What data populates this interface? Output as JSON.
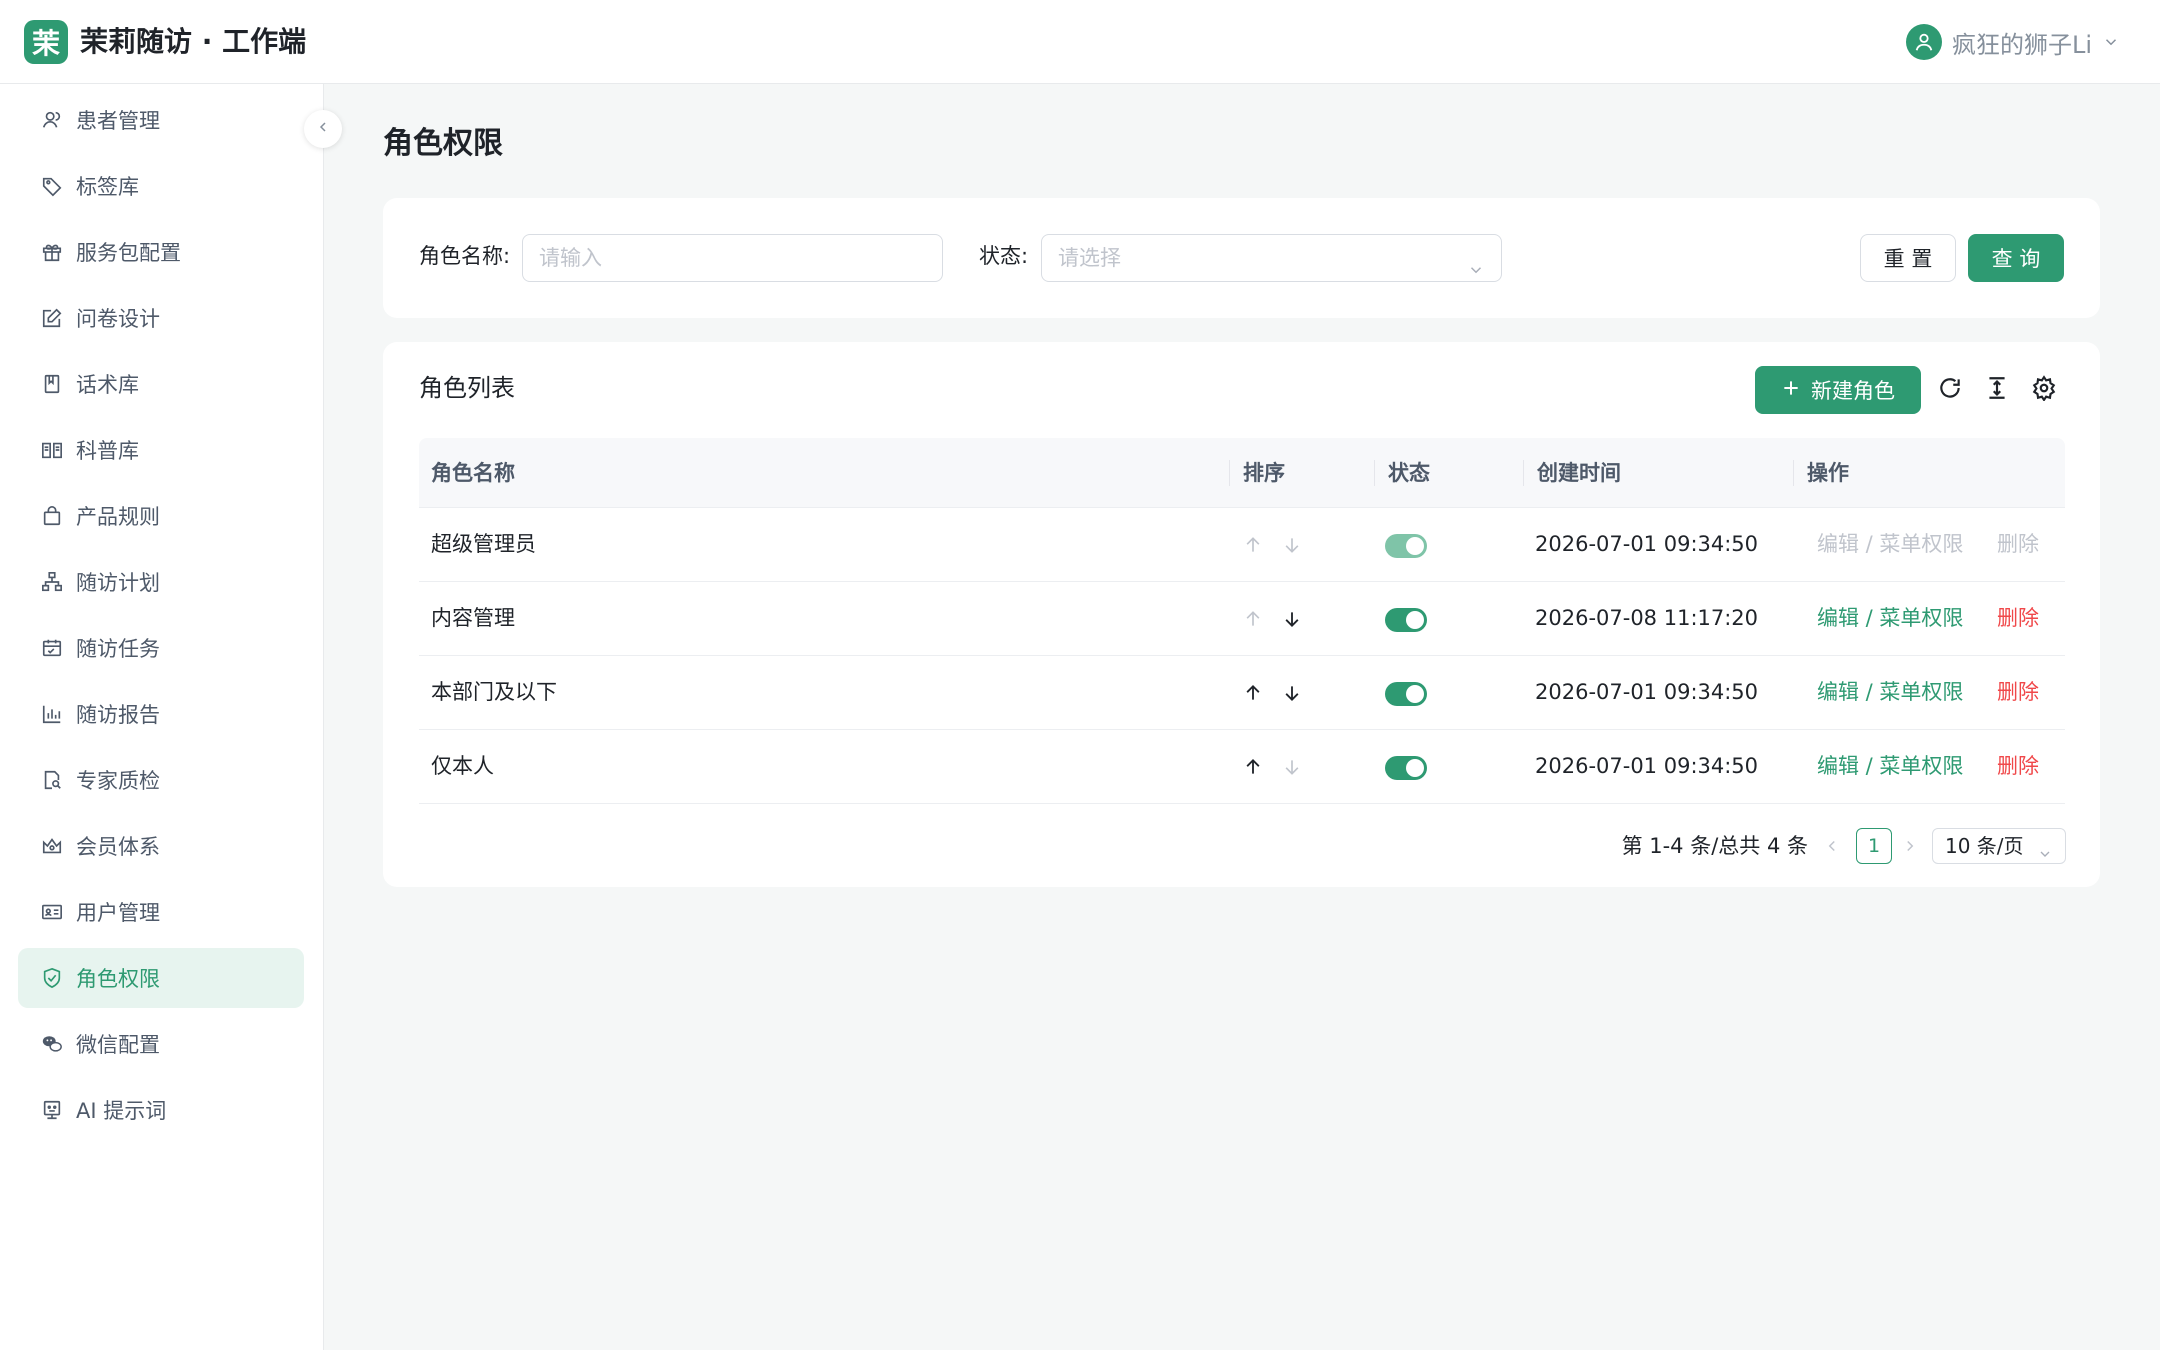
{
  "header": {
    "logo_char": "茉",
    "title": "茉莉随访 · 工作端",
    "user_name": "疯狂的狮子Li",
    "accent": "#2e9a72"
  },
  "sidebar": {
    "items": [
      {
        "label": "患者管理",
        "icon": "patients-icon"
      },
      {
        "label": "标签库",
        "icon": "tag-icon"
      },
      {
        "label": "服务包配置",
        "icon": "gift-icon"
      },
      {
        "label": "问卷设计",
        "icon": "edit-form-icon"
      },
      {
        "label": "话术库",
        "icon": "book-icon"
      },
      {
        "label": "科普库",
        "icon": "open-book-icon"
      },
      {
        "label": "产品规则",
        "icon": "bag-icon"
      },
      {
        "label": "随访计划",
        "icon": "org-chart-icon"
      },
      {
        "label": "随访任务",
        "icon": "calendar-check-icon"
      },
      {
        "label": "随访报告",
        "icon": "bar-chart-icon"
      },
      {
        "label": "专家质检",
        "icon": "doc-search-icon"
      },
      {
        "label": "会员体系",
        "icon": "crown-icon"
      },
      {
        "label": "用户管理",
        "icon": "id-card-icon"
      },
      {
        "label": "角色权限",
        "icon": "shield-icon",
        "active": true
      },
      {
        "label": "微信配置",
        "icon": "wechat-icon"
      },
      {
        "label": "AI 提示词",
        "icon": "robot-icon"
      }
    ]
  },
  "page": {
    "title": "角色权限"
  },
  "filter": {
    "role_name_label": "角色名称:",
    "role_name_placeholder": "请输入",
    "status_label": "状态:",
    "status_placeholder": "请选择",
    "reset_label": "重 置",
    "search_label": "查 询"
  },
  "list": {
    "title": "角色列表",
    "new_button_label": "新建角色",
    "columns": [
      "角色名称",
      "排序",
      "状态",
      "创建时间",
      "操作"
    ],
    "rows": [
      {
        "name": "超级管理员",
        "created": "2026-07-01 09:34:50",
        "status_on": true,
        "editable": false
      },
      {
        "name": "内容管理",
        "created": "2026-07-08 11:17:20",
        "status_on": true,
        "editable": true
      },
      {
        "name": "本部门及以下",
        "created": "2026-07-01 09:34:50",
        "status_on": true,
        "editable": true
      },
      {
        "name": "仅本人",
        "created": "2026-07-01 09:34:50",
        "status_on": true,
        "editable": true
      }
    ],
    "edit_label": "编辑 / 菜单权限",
    "delete_label": "删除"
  },
  "pagination": {
    "total_text": "第 1-4 条/总共 4 条",
    "current_page": "1",
    "page_size": "10 条/页"
  }
}
